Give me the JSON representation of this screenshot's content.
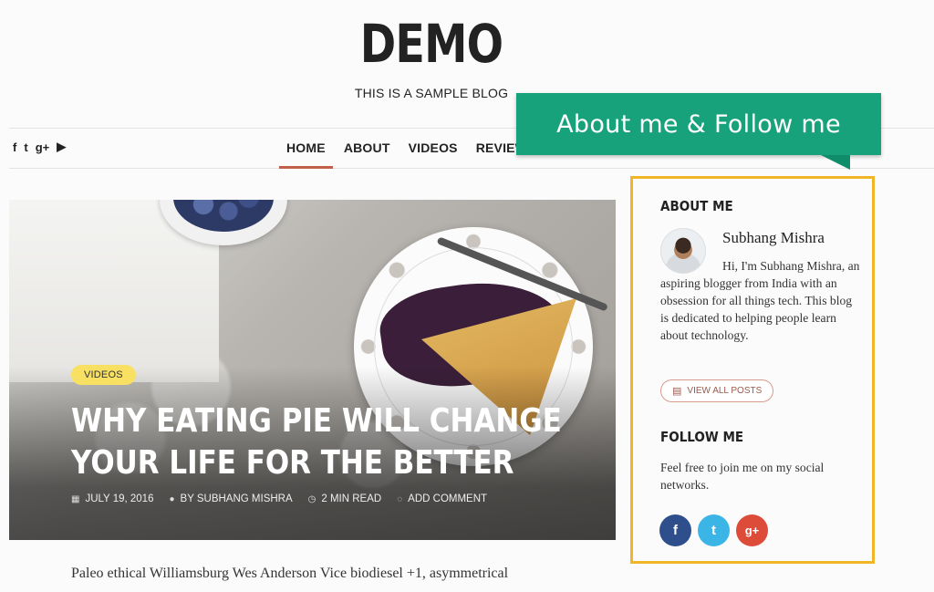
{
  "header": {
    "site_title": "DEMO",
    "tagline": "THIS IS A SAMPLE BLOG"
  },
  "social_top": [
    {
      "icon": "facebook-icon",
      "glyph": "f"
    },
    {
      "icon": "twitter-icon",
      "glyph": "t"
    },
    {
      "icon": "google-plus-icon",
      "glyph": "g+"
    },
    {
      "icon": "youtube-icon",
      "glyph": "▶"
    }
  ],
  "nav": {
    "items": [
      "HOME",
      "ABOUT",
      "VIDEOS",
      "REVIEWS"
    ],
    "active": "HOME"
  },
  "callout": {
    "text": "About me & Follow me",
    "color": "#18a27c"
  },
  "hero": {
    "category": "VIDEOS",
    "title_line1": "WHY EATING PIE WILL CHANGE",
    "title_line2": "YOUR LIFE FOR THE BETTER",
    "meta": {
      "date": "JULY 19, 2016",
      "author": "BY SUBHANG MISHRA",
      "read_time": "2 MIN READ",
      "comment": "ADD COMMENT"
    }
  },
  "excerpt": "Paleo ethical Williamsburg Wes Anderson Vice biodiesel +1, asymmetrical",
  "sidebar": {
    "border_color": "#f1b627",
    "about_heading": "ABOUT ME",
    "author_name": "Subhang Mishra",
    "bio": "Hi, I'm Subhang Mishra, an aspiring blogger from India with an obsession for all things tech. This blog is dedicated to helping people learn about technology.",
    "view_all_label": "VIEW ALL POSTS",
    "follow_heading": "FOLLOW ME",
    "follow_text": "Feel free to join me on my social networks.",
    "social": [
      {
        "icon": "facebook-icon",
        "glyph": "f",
        "color": "#2f4f8c"
      },
      {
        "icon": "twitter-icon",
        "glyph": "t",
        "color": "#3bb4e6"
      },
      {
        "icon": "google-plus-icon",
        "glyph": "g+",
        "color": "#dd4b39"
      }
    ]
  }
}
